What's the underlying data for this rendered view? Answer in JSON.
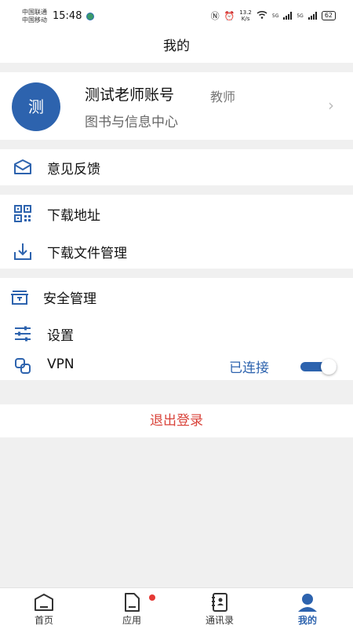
{
  "status_bar": {
    "carrier_1": "中国联通",
    "carrier_2": "中国移动",
    "time": "15:48",
    "net_speed_value": "13.2",
    "net_speed_unit": "K/s",
    "signal_1": "5G",
    "signal_2": "5G",
    "battery": "62"
  },
  "header": {
    "title": "我的"
  },
  "profile": {
    "avatar_text": "测",
    "name": "测试老师账号",
    "role": "教师",
    "org": "图书与信息中心"
  },
  "menu": {
    "feedback": "意见反馈",
    "download_url": "下载地址",
    "download_files": "下载文件管理",
    "security": "安全管理",
    "settings": "设置",
    "vpn": "VPN",
    "vpn_status": "已连接",
    "vpn_enabled": true
  },
  "logout": "退出登录",
  "tabbar": {
    "home": "首页",
    "apps": "应用",
    "contacts": "通讯录",
    "mine": "我的"
  },
  "colors": {
    "accent": "#2d63ae",
    "logout": "#d9433a",
    "badge": "#e53935"
  }
}
